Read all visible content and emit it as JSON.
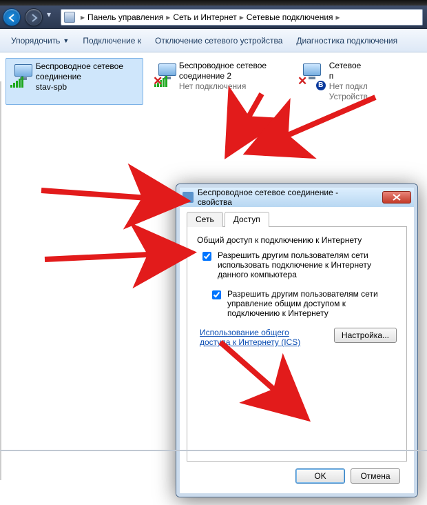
{
  "nav": {
    "crumbs": [
      "Панель управления",
      "Сеть и Интернет",
      "Сетевые подключения"
    ]
  },
  "toolbar": {
    "organize": "Упорядочить",
    "connect": "Подключение к",
    "disable": "Отключение сетевого устройства",
    "diagnose": "Диагностика подключения"
  },
  "connections": [
    {
      "title": "Беспроводное сетевое соединение",
      "status": "stav-spb",
      "state": "active"
    },
    {
      "title": "Беспроводное сетевое соединение 2",
      "status": "Нет подключения",
      "state": "disconnected"
    },
    {
      "title": "Сетевое п",
      "line2": "Нет подкл",
      "line3": "Устройств",
      "state": "bt"
    }
  ],
  "dialog": {
    "title": "Беспроводное сетевое соединение - свойства",
    "tabs": {
      "network": "Сеть",
      "sharing": "Доступ"
    },
    "group": "Общий доступ к подключению к Интернету",
    "chk1": "Разрешить другим пользователям сети использовать подключение к Интернету данного компьютера",
    "chk2": "Разрешить другим пользователям сети управление общим доступом к подключению к Интернету",
    "link": "Использование общего доступа к Интернету (ICS)",
    "settingsBtn": "Настройка...",
    "ok": "OK",
    "cancel": "Отмена"
  }
}
